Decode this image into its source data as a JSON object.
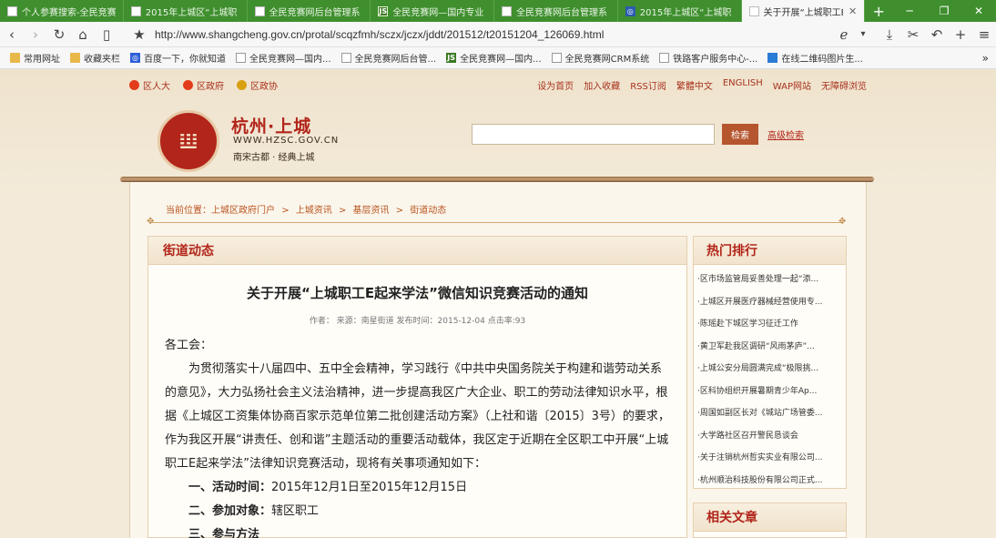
{
  "browser": {
    "tabs": [
      {
        "label": "个人参赛搜索-全民竞赛",
        "icon": "doc"
      },
      {
        "label": "2015年上城区“上城职",
        "icon": "doc"
      },
      {
        "label": "全民竞赛网后台管理系",
        "icon": "doc"
      },
      {
        "label": "全民竞赛网—国内专业",
        "icon": "js"
      },
      {
        "label": "全民竞赛网后台管理系",
        "icon": "doc"
      },
      {
        "label": "2015年上城区“上城职",
        "icon": "gov"
      },
      {
        "label": "关于开展“上城职工E",
        "icon": "doc",
        "active": true
      }
    ],
    "url": "http://www.shangcheng.gov.cn/protal/scqzfmh/sczx/jczx/jddt/201512/t20151204_126069.html",
    "bookmarks": [
      {
        "label": "常用网址",
        "icon": "folder"
      },
      {
        "label": "收藏夹栏",
        "icon": "folder"
      },
      {
        "label": "百度一下，你就知道",
        "icon": "bd"
      },
      {
        "label": "全民竞赛网—国内...",
        "icon": "page"
      },
      {
        "label": "全民竞赛网后台管...",
        "icon": "page"
      },
      {
        "label": "全民竞赛网—国内...",
        "icon": "js"
      },
      {
        "label": "全民竞赛网CRM系统",
        "icon": "page"
      },
      {
        "label": "铁路客户服务中心-...",
        "icon": "page"
      },
      {
        "label": "在线二维码图片生...",
        "icon": "lt"
      }
    ]
  },
  "site": {
    "top_left": [
      "区人大",
      "区政府",
      "区政协"
    ],
    "top_right": [
      "设为首页",
      "加入收藏",
      "RSS订阅",
      "繁體中文",
      "ENGLISH",
      "WAP网站",
      "无障碍浏览"
    ],
    "name": "杭州·上城",
    "url": "WWW.HZSC.GOV.CN",
    "slogan": "南宋古都 · 经典上城",
    "search_button": "检索",
    "advanced_search": "高级检索",
    "breadcrumb": [
      "当前位置：上城区政府门户",
      ">",
      "上城资讯",
      ">",
      "基层资讯",
      ">",
      "街道动态"
    ]
  },
  "article": {
    "section": "街道动态",
    "title": "关于开展“上城职工E起来学法”微信知识竞赛活动的通知",
    "meta": "作者：  来源：南星街道 发布时间：2015-12-04 点击率:93",
    "salutation": "各工会：",
    "paragraph": "为贯彻落实十八届四中、五中全会精神，学习践行《中共中央国务院关于构建和谐劳动关系的意见》，大力弘扬社会主义法治精神，进一步提高我区广大企业、职工的劳动法律知识水平，根据《上城区工资集体协商百家示范单位第二批创建活动方案》（上社和谐〔2015〕3号）的要求，作为我区开展“讲责任、创和谐”主题活动的重要活动载体，我区定于近期在全区职工中开展“上城职工E起来学法”法律知识竞赛活动，现将有关事项通知如下：",
    "item1_label": "一、活动时间：",
    "item1_value": "2015年12月1日至2015年12月15日",
    "item2_label": "二、参加对象：",
    "item2_value": "辖区职工",
    "item3_label": "三、参与方法"
  },
  "sidebar": {
    "hot_title": "热门排行",
    "hot_items": [
      "·区市场监管局妥善处理一起“添...",
      "·上城区开展医疗器械经营使用专...",
      "·陈瑶赴下城区学习征迁工作",
      "·黄卫军赴我区调研“风雨茅庐”...",
      "·上城公安分局圆满完成“极限挑...",
      "·区科协组织开展暑期青少年Ap...",
      "·周国如副区长对《城站广场管委...",
      "·大学路社区召开警民恳谈会",
      "·关于注销杭州哲实实业有限公司...",
      "·杭州顺治科技股份有限公司正式..."
    ],
    "related_title": "相关文章"
  }
}
